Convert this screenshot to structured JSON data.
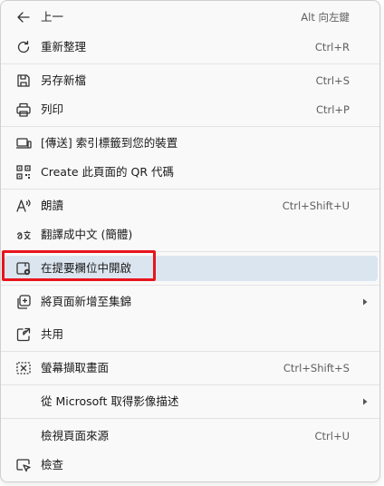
{
  "menu": {
    "items": [
      {
        "icon": "back-arrow-icon",
        "label": "上一",
        "shortcut": "Alt 向左鍵"
      },
      {
        "icon": "refresh-icon",
        "label": "重新整理",
        "shortcut": "Ctrl+R"
      },
      {
        "icon": "save-icon",
        "label": "另存新檔",
        "shortcut": "Ctrl+S"
      },
      {
        "icon": "printer-icon",
        "label": "列印",
        "shortcut": "Ctrl+P"
      },
      {
        "icon": "send-to-devices-icon",
        "label": "[傳送] 索引標籤到您的裝置",
        "shortcut": ""
      },
      {
        "icon": "qr-code-icon",
        "label": "Create 此頁面的 QR 代碼",
        "shortcut": ""
      },
      {
        "icon": "read-aloud-icon",
        "label": "朗讀",
        "shortcut": "Ctrl+Shift+U"
      },
      {
        "icon": "translate-icon",
        "label": "翻譯成中文 (簡體)",
        "shortcut": ""
      },
      {
        "icon": "open-in-sidebar-icon",
        "label": "在提要欄位中開啟",
        "shortcut": ""
      },
      {
        "icon": "add-to-collections-icon",
        "label": "將頁面新增至集錦",
        "shortcut": ""
      },
      {
        "icon": "share-icon",
        "label": "共用",
        "shortcut": ""
      },
      {
        "icon": "screenshot-icon",
        "label": "螢幕擷取畫面",
        "shortcut": "Ctrl+Shift+S"
      },
      {
        "icon": "",
        "label": "從 Microsoft 取得影像描述",
        "shortcut": ""
      },
      {
        "icon": "",
        "label": "檢視頁面來源",
        "shortcut": "Ctrl+U"
      },
      {
        "icon": "inspect-icon",
        "label": "檢查",
        "shortcut": ""
      }
    ]
  },
  "colors": {
    "highlight": "#dbe5ef",
    "red_annotation": "#e8141c",
    "menu_background": "#f9f9f9"
  }
}
